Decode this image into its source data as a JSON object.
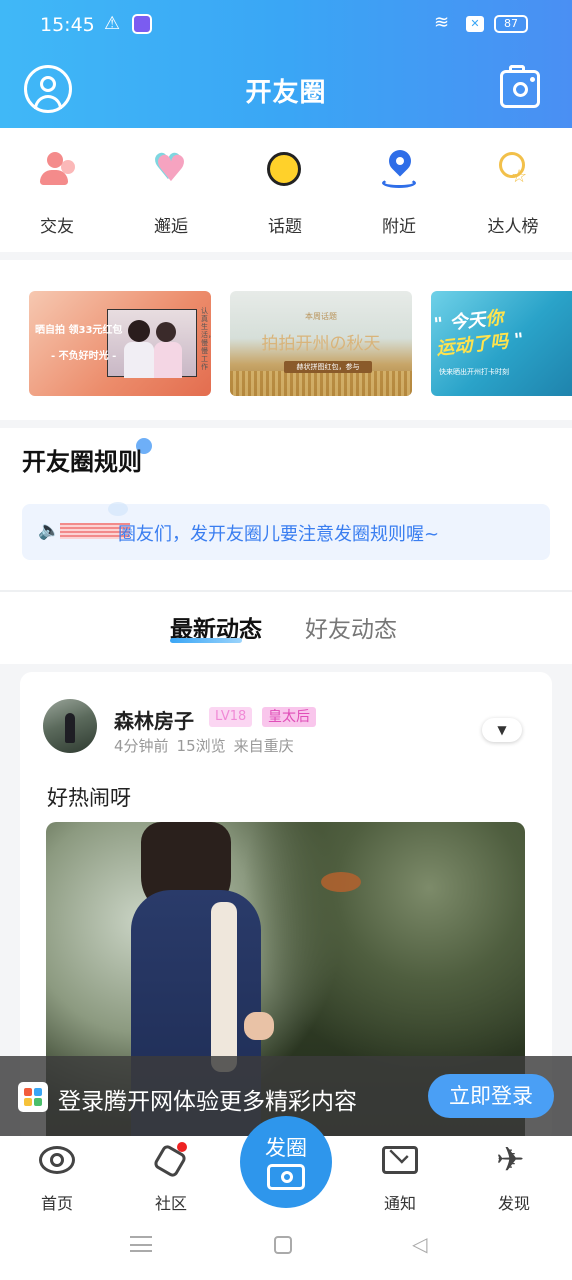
{
  "status_bar": {
    "time": "15:45",
    "battery": "87"
  },
  "header": {
    "title": "开友圈"
  },
  "quick_nav": [
    {
      "label": "交友",
      "icon": "friends-icon"
    },
    {
      "label": "邂逅",
      "icon": "hearts-icon"
    },
    {
      "label": "话题",
      "icon": "topic-bubble-icon"
    },
    {
      "label": "附近",
      "icon": "location-pin-icon"
    },
    {
      "label": "达人榜",
      "icon": "talent-star-icon"
    }
  ],
  "banners": [
    {
      "line1": "晒自拍 领33元红包",
      "line2": "- 不负好时光 -",
      "side": "认真生活，慢慢工作"
    },
    {
      "tag": "本周话题",
      "title": "拍拍开州の秋天",
      "ribbon": "赫状拼图红包，参与"
    },
    {
      "title_a": "今天",
      "title_b": "你",
      "title_c": "运动了吗",
      "sub": "快来晒出开州打卡时刻"
    }
  ],
  "rules": {
    "title": "开友圈规则",
    "notice": "圈友们，发开友圈儿要注意发圈规则喔~"
  },
  "tabs": {
    "active": "最新动态",
    "inactive": "好友动态"
  },
  "post": {
    "author": "森林房子",
    "level": "LV18",
    "role": "皇太后",
    "time": "4分钟前",
    "views": "15浏览",
    "location": "来自重庆",
    "text": "好热闹呀"
  },
  "login_banner": {
    "text": "登录腾开网体验更多精彩内容",
    "button": "立即登录"
  },
  "bottom_nav": [
    {
      "label": "首页"
    },
    {
      "label": "社区"
    },
    {
      "label": "发圈"
    },
    {
      "label": "通知"
    },
    {
      "label": "发现"
    }
  ],
  "colors": {
    "brand": "#3aa6f5",
    "notice_text": "#3a7ef0",
    "login_button": "#4a9ff5"
  }
}
